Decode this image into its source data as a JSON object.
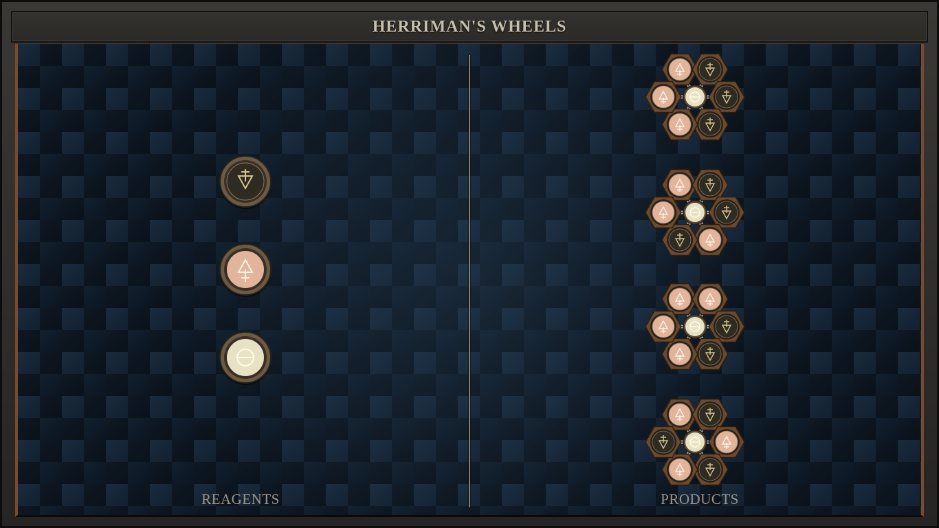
{
  "title": "HERRIMAN'S WHEELS",
  "labels": {
    "reagents": "REAGENTS",
    "products": "PRODUCTS"
  },
  "colors": {
    "light_atom": "#e2b49b",
    "dark_atom": "#2e2b22",
    "center_atom": "#e8e2c4",
    "bronze": "#a8825a"
  },
  "reagents": [
    {
      "symbol": "dark-down-triangle-icon",
      "kind": "dark"
    },
    {
      "symbol": "light-up-triangle-icon",
      "kind": "light"
    },
    {
      "symbol": "salt-circle-icon",
      "kind": "center"
    }
  ],
  "products": [
    {
      "atoms": [
        "light",
        "dark",
        "dark",
        "dark",
        "light",
        "light"
      ]
    },
    {
      "atoms": [
        "light",
        "dark",
        "dark",
        "light",
        "dark",
        "light"
      ]
    },
    {
      "atoms": [
        "light",
        "light",
        "dark",
        "dark",
        "light",
        "light"
      ]
    },
    {
      "atoms": [
        "light",
        "dark",
        "light",
        "dark",
        "light",
        "dark"
      ]
    }
  ]
}
